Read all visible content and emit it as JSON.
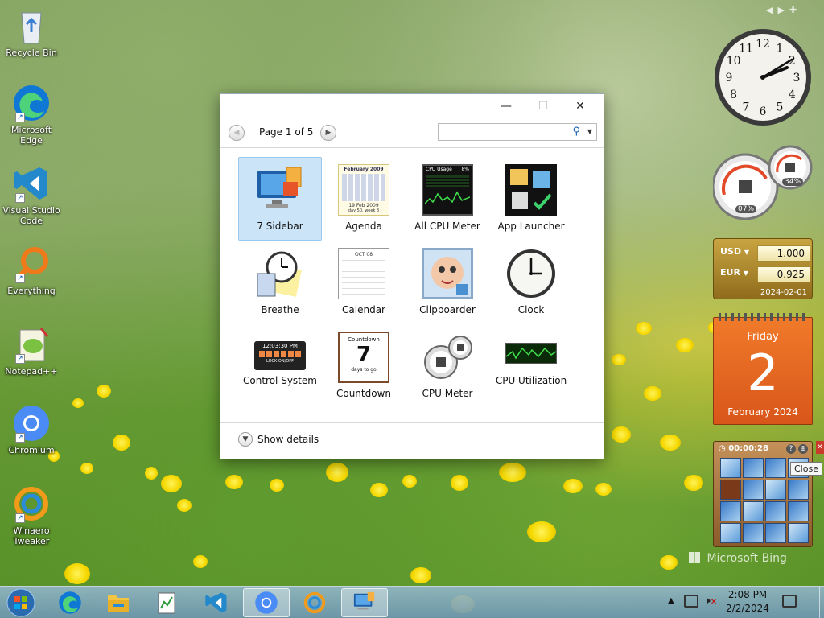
{
  "desktop_icons": [
    {
      "label": "Recycle Bin",
      "icon": "recycle-bin-icon"
    },
    {
      "label": "Microsoft Edge",
      "icon": "edge-icon"
    },
    {
      "label": "Visual Studio Code",
      "icon": "vscode-icon"
    },
    {
      "label": "Everything",
      "icon": "everything-search-icon"
    },
    {
      "label": "Notepad++",
      "icon": "notepadpp-icon"
    },
    {
      "label": "Chromium",
      "icon": "chromium-icon"
    },
    {
      "label": "Winaero Tweaker",
      "icon": "winaero-tweaker-icon"
    }
  ],
  "dialog": {
    "minimize_glyph": "—",
    "maximize_glyph": "☐",
    "close_glyph": "✕",
    "page_label": "Page 1 of 5",
    "search_placeholder": "",
    "show_details": "Show details",
    "gadgets": [
      {
        "label": "7 Sidebar",
        "selected": true
      },
      {
        "label": "Agenda"
      },
      {
        "label": "All CPU Meter"
      },
      {
        "label": "App Launcher"
      },
      {
        "label": "Breathe"
      },
      {
        "label": "Calendar"
      },
      {
        "label": "Clipboarder"
      },
      {
        "label": "Clock"
      },
      {
        "label": "Control System"
      },
      {
        "label": "Countdown"
      },
      {
        "label": "CPU Meter"
      },
      {
        "label": "CPU Utilization"
      }
    ],
    "thumbnail_text": {
      "agenda_month": "February 2009",
      "agenda_footer": "19 Feb 2009",
      "agenda_week": "day 50, week 8",
      "cpu_usage_title": "CPU Usage",
      "cpu_usage_pct": "8%",
      "calendar_month": "OCT 08",
      "control_time": "12:03:30 PM",
      "control_lock": "LOCK ON/OFF",
      "countdown_title": "Countdown",
      "countdown_value": "7",
      "countdown_sub": "days to go"
    }
  },
  "sidebar_gadgets": {
    "clock_numerals": [
      "12",
      "1",
      "2",
      "3",
      "4",
      "5",
      "6",
      "7",
      "8",
      "9",
      "10",
      "11"
    ],
    "cpu_pct": "07%",
    "mem_pct": "34%",
    "currency": {
      "rows": [
        {
          "code": "USD",
          "value": "1.000"
        },
        {
          "code": "EUR",
          "value": "0.925"
        }
      ],
      "date": "2024-02-01"
    },
    "calendar": {
      "weekday": "Friday",
      "day": "2",
      "month_year": "February 2024"
    },
    "puzzle": {
      "time": "00:00:28"
    },
    "tooltip": "Close"
  },
  "watermark": "Microsoft Bing",
  "taskbar": {
    "time": "2:08 PM",
    "date": "2/2/2024",
    "items": [
      {
        "name": "start-button",
        "icon": "windows-logo-icon"
      },
      {
        "name": "taskbar-edge",
        "icon": "edge-icon"
      },
      {
        "name": "taskbar-file-explorer",
        "icon": "folder-icon"
      },
      {
        "name": "taskbar-notepad-app",
        "icon": "notepad-chart-icon"
      },
      {
        "name": "taskbar-vscode",
        "icon": "vscode-icon"
      },
      {
        "name": "taskbar-chromium",
        "icon": "chromium-icon"
      },
      {
        "name": "taskbar-winaero",
        "icon": "winaero-tweaker-icon"
      },
      {
        "name": "taskbar-gadgets",
        "icon": "gadgets-window-icon",
        "active": true
      }
    ]
  },
  "colors": {
    "selection": "#cce4f7",
    "calendar_orange": "#e8641c",
    "currency_gold": "#b58f2a"
  }
}
